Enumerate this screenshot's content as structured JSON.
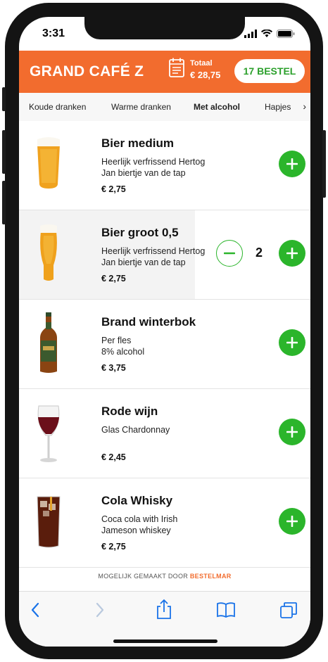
{
  "status": {
    "time": "3:31"
  },
  "header": {
    "brand": "GRAND CAFÉ Z",
    "total_label": "Totaal",
    "total_value": "€ 28,75",
    "order_label": "17 BESTEL",
    "accent_color": "#f26c2e"
  },
  "tabs": [
    {
      "label": "Koude dranken",
      "active": false
    },
    {
      "label": "Warme dranken",
      "active": false
    },
    {
      "label": "Met alcohol",
      "active": true
    },
    {
      "label": "Hapjes",
      "active": false
    }
  ],
  "items": [
    {
      "name": "Bier medium",
      "desc1": "Heerlijk verfrissend Hertog",
      "desc2": "Jan biertje van de tap",
      "price": "€ 2,75",
      "icon": "beer-glass-medium-icon"
    },
    {
      "name": "Bier groot 0,5",
      "desc1": "Heerlijk verfrissend Hertog",
      "desc2": "Jan biertje van de tap",
      "price": "€ 2,75",
      "icon": "beer-glass-large-icon",
      "quantity": "2"
    },
    {
      "name": "Brand winterbok",
      "desc1": "Per fles",
      "desc2": "8% alcohol",
      "price": "€ 3,75",
      "icon": "beer-bottle-icon"
    },
    {
      "name": "Rode wijn",
      "desc1": "Glas Chardonnay",
      "desc2": "",
      "price": "€ 2,45",
      "icon": "wine-glass-icon"
    },
    {
      "name": "Cola Whisky",
      "desc1": "Coca cola with Irish",
      "desc2": "Jameson whiskey",
      "price": "€ 2,75",
      "icon": "cola-glass-icon"
    }
  ],
  "footer": {
    "prefix": "MOGELIJK GEMAAKT DOOR",
    "link": "BESTELMAR"
  },
  "colors": {
    "green": "#2bb52b",
    "orange": "#f26c2e"
  }
}
